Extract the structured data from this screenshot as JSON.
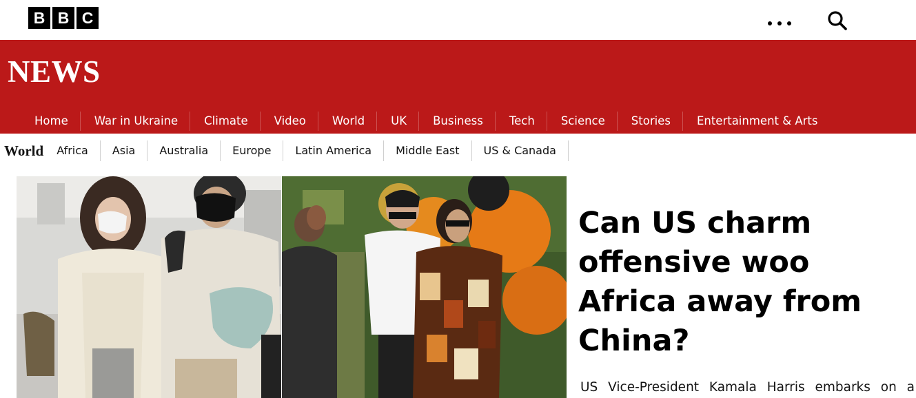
{
  "header": {
    "logo_letters": [
      "B",
      "B",
      "C"
    ],
    "more_icon": "ellipsis-icon",
    "search_icon": "search-icon"
  },
  "masthead": {
    "title": "NEWS",
    "background_color": "#bb1919"
  },
  "primary_nav": {
    "items": [
      "Home",
      "War in Ukraine",
      "Climate",
      "Video",
      "World",
      "UK",
      "Business",
      "Tech",
      "Science",
      "Stories",
      "Entertainment & Arts"
    ]
  },
  "secondary_nav": {
    "section": "World",
    "items": [
      "Africa",
      "Asia",
      "Australia",
      "Europe",
      "Latin America",
      "Middle East",
      "US & Canada"
    ]
  },
  "article": {
    "headline": "Can US charm offensive woo Africa away from China?",
    "summary": "US Vice-President Kamala Harris embarks on a"
  }
}
